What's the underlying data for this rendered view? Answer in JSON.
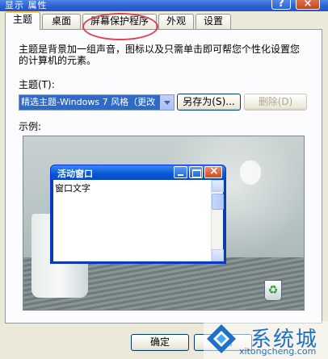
{
  "window": {
    "title": "显示 属性",
    "help_label": "?",
    "close_label": "×"
  },
  "tabs": [
    {
      "label": "主题",
      "active": true
    },
    {
      "label": "桌面",
      "active": false
    },
    {
      "label": "屏幕保护程序",
      "active": false
    },
    {
      "label": "外观",
      "active": false
    },
    {
      "label": "设置",
      "active": false
    }
  ],
  "themes_tab": {
    "description": "主题是背景加一组声音，图标以及只需单击即可帮您个性化设置您的计算机的元素。",
    "theme_label": "主题(T):",
    "theme_selected": "精选主题-Windows 7 风格（更改",
    "save_as_label": "另存为(S)...",
    "delete_label": "删除(D)",
    "sample_label": "示例:"
  },
  "preview": {
    "window_title": "活动窗口",
    "window_text": "窗口文字",
    "recycle_glyph": "♻"
  },
  "footer": {
    "ok_label": "确定",
    "cancel_label": "取消"
  },
  "watermark": {
    "name": "系统城",
    "domain": "xitongcheng.com",
    "brand_color": "#1e6fc6"
  },
  "colors": {
    "selection": "#316ac5",
    "highlight_ellipse": "#e04050"
  }
}
